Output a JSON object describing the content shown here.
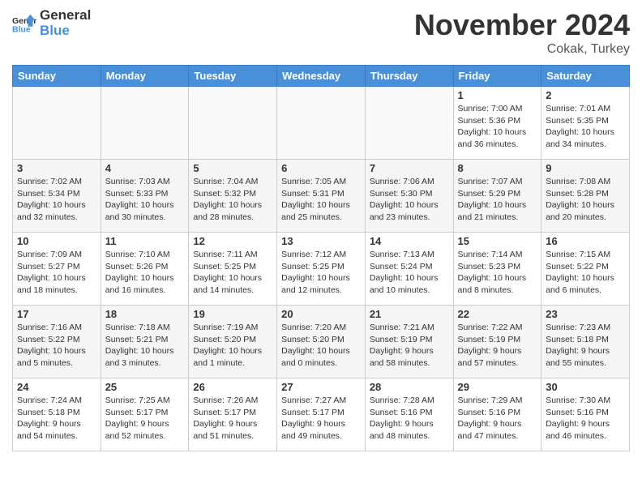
{
  "header": {
    "logo_line1": "General",
    "logo_line2": "Blue",
    "month_title": "November 2024",
    "location": "Cokak, Turkey"
  },
  "days_of_week": [
    "Sunday",
    "Monday",
    "Tuesday",
    "Wednesday",
    "Thursday",
    "Friday",
    "Saturday"
  ],
  "weeks": [
    {
      "days": [
        {
          "num": "",
          "detail": ""
        },
        {
          "num": "",
          "detail": ""
        },
        {
          "num": "",
          "detail": ""
        },
        {
          "num": "",
          "detail": ""
        },
        {
          "num": "",
          "detail": ""
        },
        {
          "num": "1",
          "detail": "Sunrise: 7:00 AM\nSunset: 5:36 PM\nDaylight: 10 hours and 36 minutes."
        },
        {
          "num": "2",
          "detail": "Sunrise: 7:01 AM\nSunset: 5:35 PM\nDaylight: 10 hours and 34 minutes."
        }
      ]
    },
    {
      "days": [
        {
          "num": "3",
          "detail": "Sunrise: 7:02 AM\nSunset: 5:34 PM\nDaylight: 10 hours and 32 minutes."
        },
        {
          "num": "4",
          "detail": "Sunrise: 7:03 AM\nSunset: 5:33 PM\nDaylight: 10 hours and 30 minutes."
        },
        {
          "num": "5",
          "detail": "Sunrise: 7:04 AM\nSunset: 5:32 PM\nDaylight: 10 hours and 28 minutes."
        },
        {
          "num": "6",
          "detail": "Sunrise: 7:05 AM\nSunset: 5:31 PM\nDaylight: 10 hours and 25 minutes."
        },
        {
          "num": "7",
          "detail": "Sunrise: 7:06 AM\nSunset: 5:30 PM\nDaylight: 10 hours and 23 minutes."
        },
        {
          "num": "8",
          "detail": "Sunrise: 7:07 AM\nSunset: 5:29 PM\nDaylight: 10 hours and 21 minutes."
        },
        {
          "num": "9",
          "detail": "Sunrise: 7:08 AM\nSunset: 5:28 PM\nDaylight: 10 hours and 20 minutes."
        }
      ]
    },
    {
      "days": [
        {
          "num": "10",
          "detail": "Sunrise: 7:09 AM\nSunset: 5:27 PM\nDaylight: 10 hours and 18 minutes."
        },
        {
          "num": "11",
          "detail": "Sunrise: 7:10 AM\nSunset: 5:26 PM\nDaylight: 10 hours and 16 minutes."
        },
        {
          "num": "12",
          "detail": "Sunrise: 7:11 AM\nSunset: 5:25 PM\nDaylight: 10 hours and 14 minutes."
        },
        {
          "num": "13",
          "detail": "Sunrise: 7:12 AM\nSunset: 5:25 PM\nDaylight: 10 hours and 12 minutes."
        },
        {
          "num": "14",
          "detail": "Sunrise: 7:13 AM\nSunset: 5:24 PM\nDaylight: 10 hours and 10 minutes."
        },
        {
          "num": "15",
          "detail": "Sunrise: 7:14 AM\nSunset: 5:23 PM\nDaylight: 10 hours and 8 minutes."
        },
        {
          "num": "16",
          "detail": "Sunrise: 7:15 AM\nSunset: 5:22 PM\nDaylight: 10 hours and 6 minutes."
        }
      ]
    },
    {
      "days": [
        {
          "num": "17",
          "detail": "Sunrise: 7:16 AM\nSunset: 5:22 PM\nDaylight: 10 hours and 5 minutes."
        },
        {
          "num": "18",
          "detail": "Sunrise: 7:18 AM\nSunset: 5:21 PM\nDaylight: 10 hours and 3 minutes."
        },
        {
          "num": "19",
          "detail": "Sunrise: 7:19 AM\nSunset: 5:20 PM\nDaylight: 10 hours and 1 minute."
        },
        {
          "num": "20",
          "detail": "Sunrise: 7:20 AM\nSunset: 5:20 PM\nDaylight: 10 hours and 0 minutes."
        },
        {
          "num": "21",
          "detail": "Sunrise: 7:21 AM\nSunset: 5:19 PM\nDaylight: 9 hours and 58 minutes."
        },
        {
          "num": "22",
          "detail": "Sunrise: 7:22 AM\nSunset: 5:19 PM\nDaylight: 9 hours and 57 minutes."
        },
        {
          "num": "23",
          "detail": "Sunrise: 7:23 AM\nSunset: 5:18 PM\nDaylight: 9 hours and 55 minutes."
        }
      ]
    },
    {
      "days": [
        {
          "num": "24",
          "detail": "Sunrise: 7:24 AM\nSunset: 5:18 PM\nDaylight: 9 hours and 54 minutes."
        },
        {
          "num": "25",
          "detail": "Sunrise: 7:25 AM\nSunset: 5:17 PM\nDaylight: 9 hours and 52 minutes."
        },
        {
          "num": "26",
          "detail": "Sunrise: 7:26 AM\nSunset: 5:17 PM\nDaylight: 9 hours and 51 minutes."
        },
        {
          "num": "27",
          "detail": "Sunrise: 7:27 AM\nSunset: 5:17 PM\nDaylight: 9 hours and 49 minutes."
        },
        {
          "num": "28",
          "detail": "Sunrise: 7:28 AM\nSunset: 5:16 PM\nDaylight: 9 hours and 48 minutes."
        },
        {
          "num": "29",
          "detail": "Sunrise: 7:29 AM\nSunset: 5:16 PM\nDaylight: 9 hours and 47 minutes."
        },
        {
          "num": "30",
          "detail": "Sunrise: 7:30 AM\nSunset: 5:16 PM\nDaylight: 9 hours and 46 minutes."
        }
      ]
    }
  ]
}
